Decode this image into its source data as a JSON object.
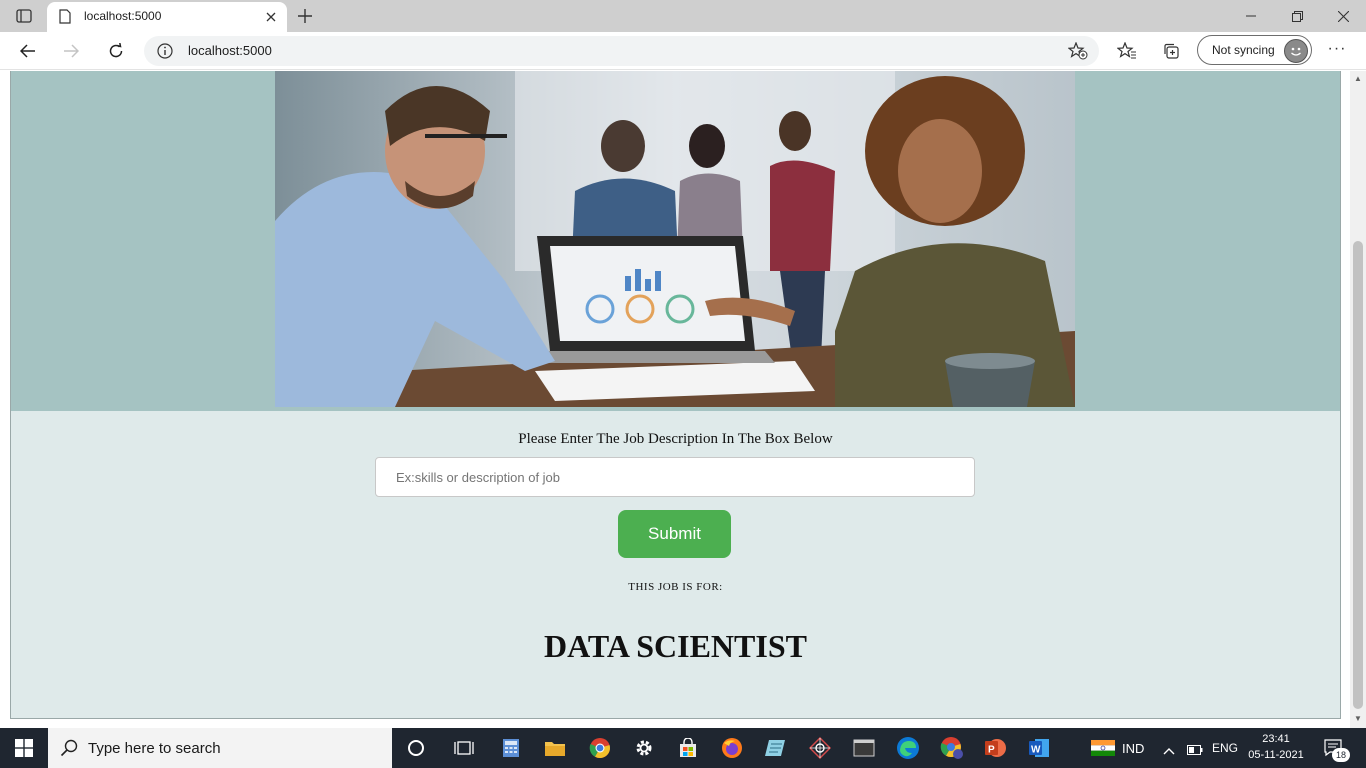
{
  "browser": {
    "tab_title": "localhost:5000",
    "address": "localhost:5000",
    "sync_label": "Not syncing",
    "more_label": "···"
  },
  "page": {
    "prompt": "Please Enter The Job Description In The Box Below",
    "input_placeholder": "Ex:skills or description of job",
    "input_value": "",
    "submit_label": "Submit",
    "result_label": "THIS JOB IS FOR:",
    "result_value": "DATA SCIENTIST"
  },
  "taskbar": {
    "search_placeholder": "Type here to search",
    "region": "IND",
    "language": "ENG",
    "time": "23:41",
    "date": "05-11-2021",
    "notification_count": "18"
  },
  "colors": {
    "hero_background": "#a5c3c2",
    "page_background": "#dfeaea",
    "submit_button": "#4caf50",
    "taskbar": "#1f2630"
  }
}
